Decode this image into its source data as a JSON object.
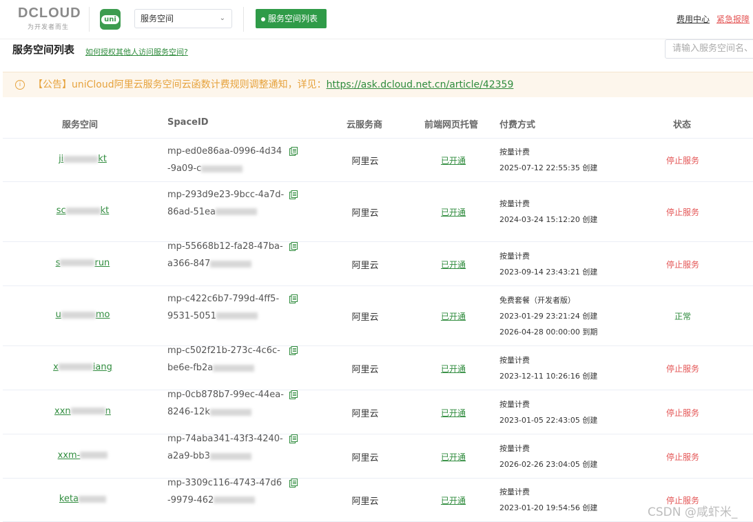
{
  "header": {
    "logo_text": "DCLOUD",
    "logo_sub": "为开发者而生",
    "app_icon_label": "uni",
    "space_select": "服务空间",
    "list_button": "服务空间列表",
    "fee_center": "费用中心",
    "emergency_report": "紧急报障"
  },
  "title_row": {
    "title": "服务空间列表",
    "help_link": "如何授权其他人访问服务空间?",
    "search_placeholder": "请输入服务空间名、"
  },
  "notice": {
    "icon": "info-icon",
    "text": "【公告】uniCloud阿里云服务空间云函数计费规则调整通知，详见：",
    "link": "https://ask.dcloud.net.cn/article/42359"
  },
  "table": {
    "columns": [
      "服务空间",
      "SpaceID",
      "云服务商",
      "前端网页托管",
      "付费方式",
      "状态"
    ],
    "rows": [
      {
        "name_a": "ji",
        "name_b": "kt",
        "id_a": "mp-ed0e86aa-0996-4d34-9a09-c",
        "provider": "阿里云",
        "hosting": "已开通",
        "pay": [
          "按量计费",
          "2025-07-12 22:55:35 创建"
        ],
        "status": "停止服务"
      },
      {
        "name_a": "sc",
        "name_b": "kt",
        "id_a": "mp-293d9e23-9bcc-4a7d-86ad-51ea",
        "provider": "阿里云",
        "hosting": "已开通",
        "pay": [
          "按量计费",
          "2024-03-24 15:12:20 创建"
        ],
        "status": "停止服务"
      },
      {
        "name_a": "s",
        "name_b": "run",
        "id_a": "mp-55668b12-fa28-47ba-a366-847",
        "provider": "阿里云",
        "hosting": "已开通",
        "pay": [
          "按量计费",
          "2023-09-14 23:43:21 创建"
        ],
        "status": "停止服务"
      },
      {
        "name_a": "u",
        "name_b": "mo",
        "id_a": "mp-c422c6b7-799d-4ff5-9531-5051",
        "provider": "阿里云",
        "hosting": "已开通",
        "pay": [
          "免费套餐（开发者版）",
          "2023-01-29 23:21:24 创建",
          "2026-04-28 00:00:00 到期"
        ],
        "status": "正常"
      },
      {
        "name_a": "x",
        "name_b": "iang",
        "id_a": "mp-c502f21b-273c-4c6c-be6e-fb2a",
        "provider": "阿里云",
        "hosting": "已开通",
        "pay": [
          "按量计费",
          "2023-12-11 10:26:16 创建"
        ],
        "status": "停止服务"
      },
      {
        "name_a": "xxn",
        "name_b": "n",
        "id_a": "mp-0cb878b7-99ec-44ea-8246-12k",
        "provider": "阿里云",
        "hosting": "已开通",
        "pay": [
          "按量计费",
          "2023-01-05 22:43:05 创建"
        ],
        "status": "停止服务"
      },
      {
        "name_a": "xxm-",
        "name_b": "",
        "id_a": "mp-74aba341-43f3-4240-a2a9-bb3",
        "provider": "阿里云",
        "hosting": "已开通",
        "pay": [
          "按量计费",
          "2026-02-26 23:04:05 创建"
        ],
        "status": "停止服务"
      },
      {
        "name_a": "keta",
        "name_b": "",
        "id_a": "mp-3309c116-4743-47d6-9979-462",
        "provider": "阿里云",
        "hosting": "已开通",
        "pay": [
          "按量计费",
          "2023-01-20 19:54:56 创建"
        ],
        "status": "停止服务"
      }
    ]
  },
  "watermark": "CSDN @咸虾米_",
  "colors": {
    "accent": "#2f9b48",
    "danger": "#e45656",
    "warn": "#e6a23c"
  }
}
